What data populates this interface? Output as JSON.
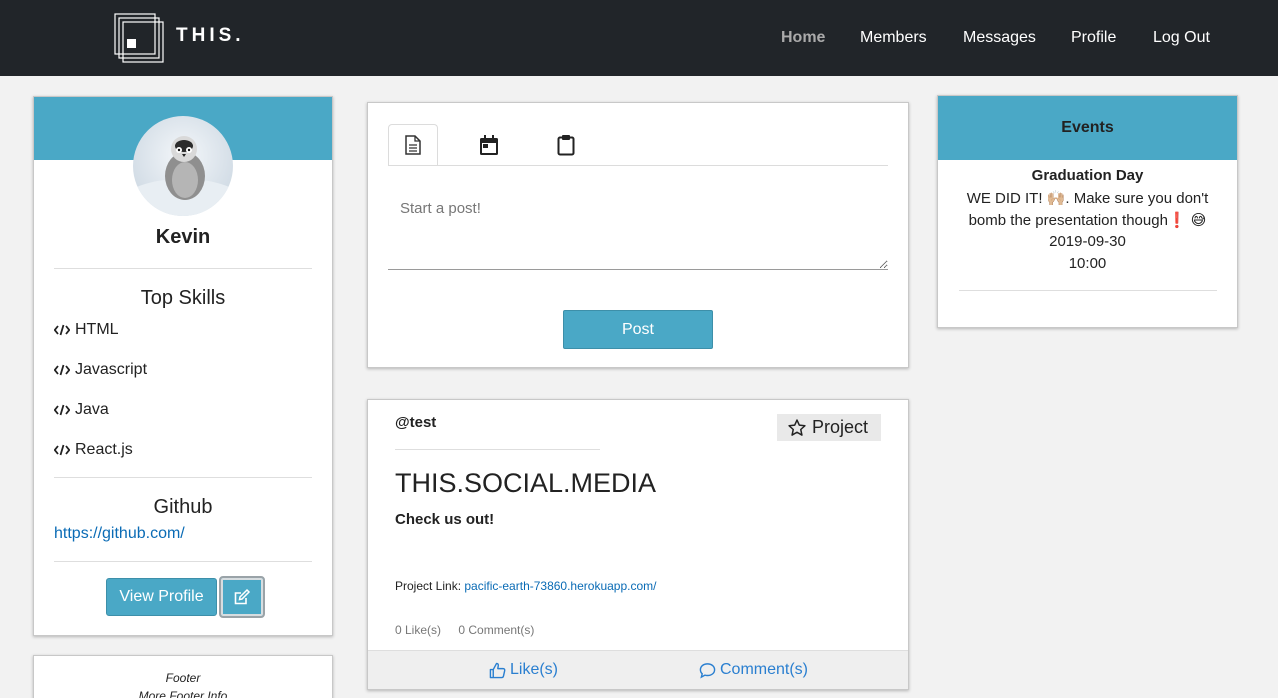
{
  "nav": {
    "brand": "THIS.",
    "links": [
      "Home",
      "Members",
      "Messages",
      "Profile",
      "Log Out"
    ]
  },
  "profile": {
    "name": "Kevin",
    "skills_title": "Top Skills",
    "skills": [
      "HTML",
      "Javascript",
      "Java",
      "React.js"
    ],
    "github_title": "Github",
    "github_url": "https://github.com/",
    "view_profile_label": "View Profile",
    "icons": {
      "skill": "code-icon",
      "edit": "edit-icon"
    }
  },
  "footer": {
    "line1": "Footer",
    "line2": "More Footer Info"
  },
  "composer": {
    "tabs": [
      "post-tab-document-icon",
      "event-tab-calendar-icon",
      "project-tab-clipboard-icon"
    ],
    "placeholder": "Start a post!",
    "post_label": "Post"
  },
  "post": {
    "user": "@test",
    "badge": "Project",
    "title": "THIS.SOCIAL.MEDIA",
    "body": "Check us out!",
    "link_label": "Project Link: ",
    "link_url": "pacific-earth-73860.herokuapp.com/",
    "likes": "0 Like(s)",
    "comments": "0 Comment(s)",
    "like_action": "Like(s)",
    "comment_action": "Comment(s)"
  },
  "events": {
    "header": "Events",
    "items": [
      {
        "title": "Graduation Day",
        "desc1": "WE DID IT! 🙌🏼. Make sure you don't",
        "desc2": "bomb the presentation though❗ 😅",
        "date": "2019-09-30",
        "time": "10:00"
      }
    ]
  },
  "colors": {
    "nav_bg": "#212529",
    "accent": "#4aa8c6",
    "link": "#0a6bb5",
    "page_bg": "#f2f2f2"
  }
}
